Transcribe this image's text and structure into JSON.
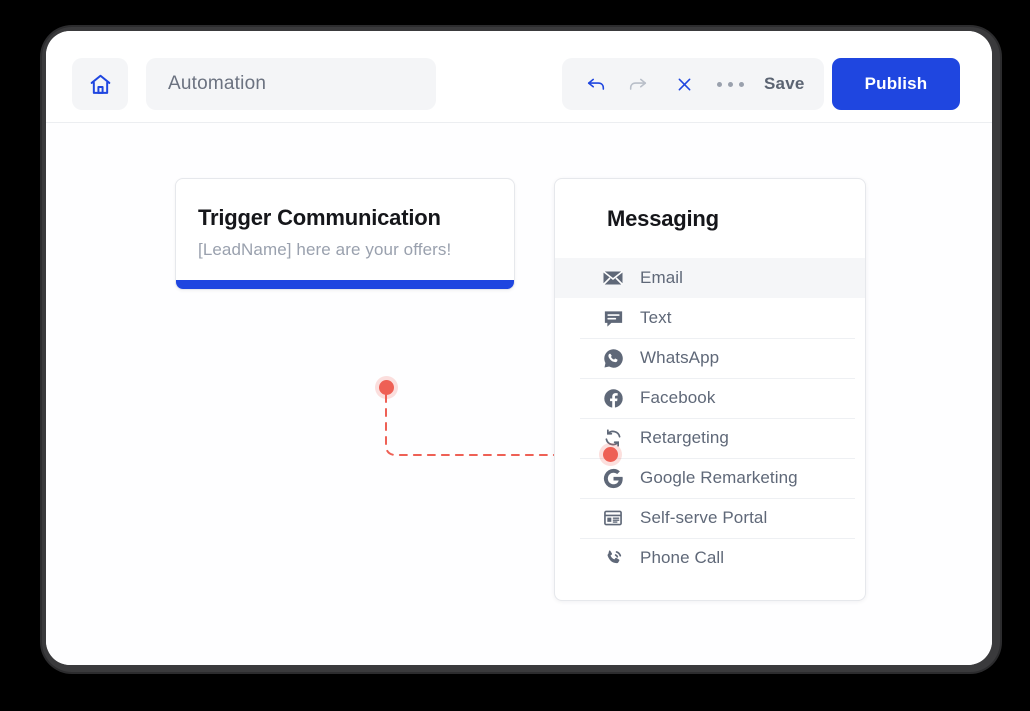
{
  "header": {
    "home_icon": "home-icon",
    "title_value": "Automation",
    "title_placeholder": "Automation",
    "tools": [
      {
        "name": "undo-button",
        "icon": "undo-arrow-icon",
        "state": "active"
      },
      {
        "name": "redo-button",
        "icon": "redo-arrow-icon",
        "state": "disabled"
      },
      {
        "name": "close-button",
        "icon": "close-x-icon",
        "state": "active"
      },
      {
        "name": "more-button",
        "icon": "more-dots-icon",
        "state": "active"
      }
    ],
    "save_label": "Save",
    "publish_label": "Publish"
  },
  "trigger_card": {
    "title": "Trigger Communication",
    "subtitle": "[LeadName] here are your offers!"
  },
  "messaging_panel": {
    "heading": "Messaging",
    "items": [
      {
        "label": "Email",
        "icon": "envelope-icon",
        "selected": true
      },
      {
        "label": "Text",
        "icon": "chat-bubble-icon",
        "selected": false
      },
      {
        "label": "WhatsApp",
        "icon": "whatsapp-icon",
        "selected": false
      },
      {
        "label": "Facebook",
        "icon": "facebook-icon",
        "selected": false
      },
      {
        "label": "Retargeting",
        "icon": "refresh-cycle-icon",
        "selected": false
      },
      {
        "label": "Google Remarketing",
        "icon": "google-g-icon",
        "selected": false
      },
      {
        "label": "Self-serve Portal",
        "icon": "browser-window-icon",
        "selected": false
      },
      {
        "label": "Phone Call",
        "icon": "phone-call-icon",
        "selected": false
      }
    ]
  },
  "colors": {
    "accent_blue": "#1f46e0",
    "connector_red": "#ee6055",
    "icon_slate": "#5f6878",
    "text_muted": "#9aa1ae"
  }
}
